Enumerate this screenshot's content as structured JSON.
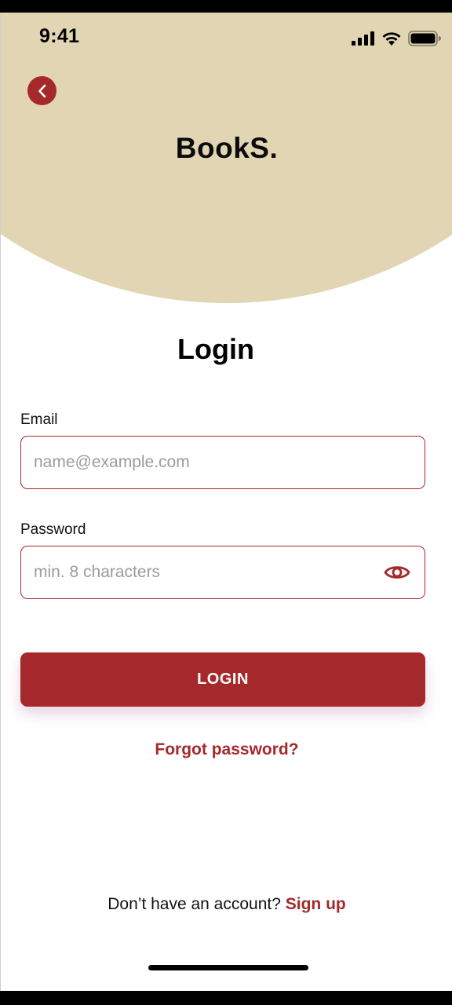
{
  "status_bar": {
    "time": "9:41"
  },
  "header": {
    "logo": "BookS.",
    "back_icon": "chevron-left-icon"
  },
  "title": "Login",
  "email": {
    "label": "Email",
    "placeholder": "name@example.com",
    "value": ""
  },
  "password": {
    "label": "Password",
    "placeholder": "min. 8 characters",
    "value": "",
    "toggle_icon": "eye-icon"
  },
  "login_button": "LOGIN",
  "forgot_password": "Forgot password?",
  "signup": {
    "prompt": "Don’t have an account?",
    "link": "Sign up"
  },
  "colors": {
    "accent": "#a5292b",
    "header_background": "#e1d5b3"
  }
}
